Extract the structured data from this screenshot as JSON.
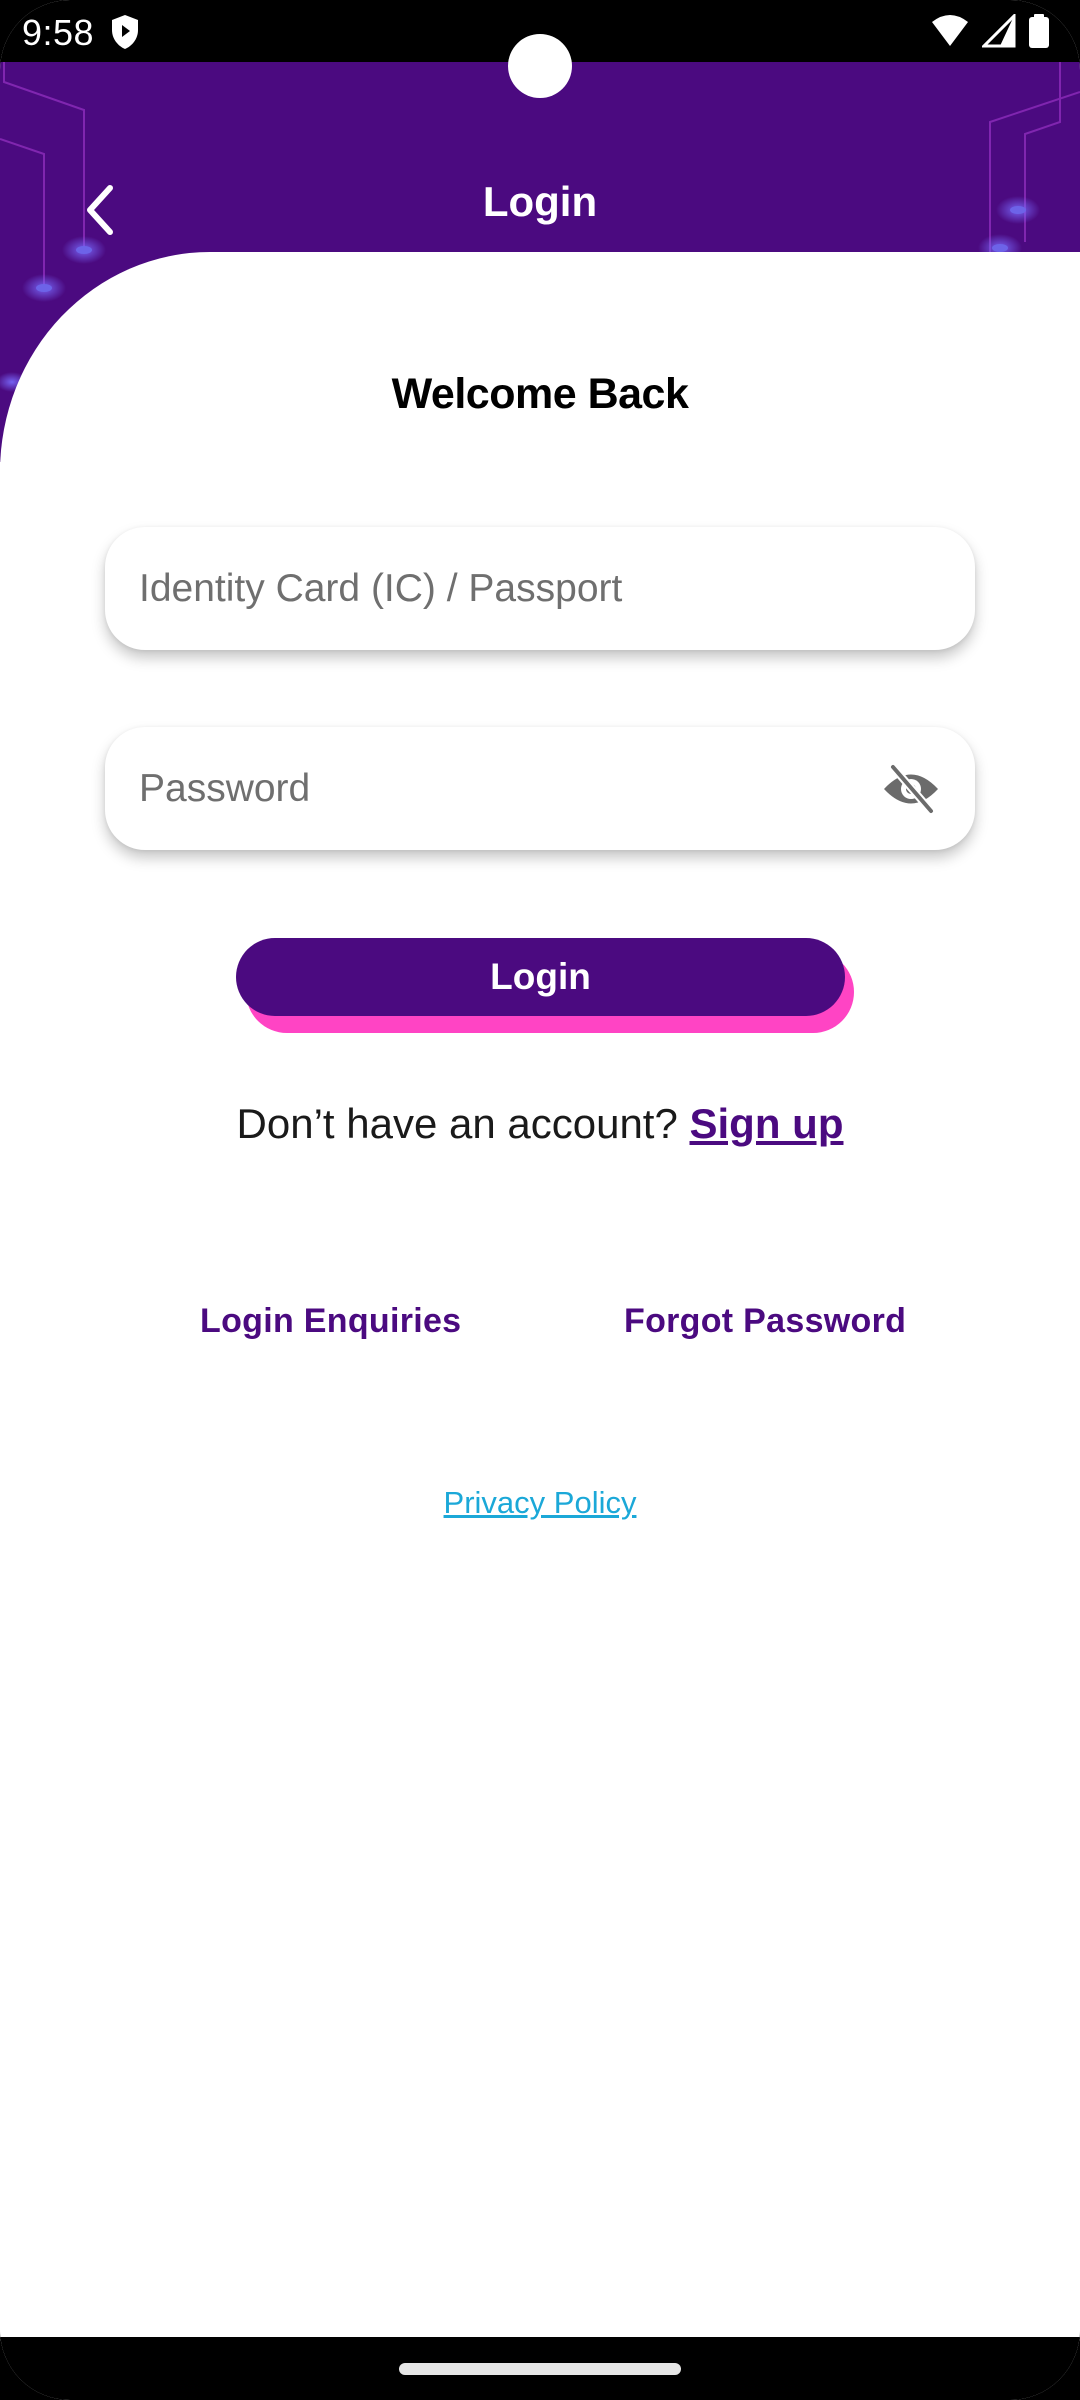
{
  "status_bar": {
    "time": "9:58",
    "left_icons": [
      "shield-play-icon"
    ],
    "right_icons": [
      "wifi-icon",
      "cell-signal-icon",
      "battery-icon"
    ]
  },
  "header": {
    "title": "Login",
    "back_icon": "chevron-left-icon",
    "background_color": "#4B0A80"
  },
  "main": {
    "heading": "Welcome Back",
    "ic_field": {
      "placeholder": "Identity Card (IC) / Passport",
      "value": ""
    },
    "password_field": {
      "placeholder": "Password",
      "value": "",
      "toggle_icon": "eye-off-icon"
    },
    "login_button": {
      "label": "Login",
      "color": "#4B0A80",
      "shadow_color": "#FF44C4"
    },
    "signup_prompt": "Don’t have an account?",
    "signup_link": "Sign up",
    "links": {
      "login_enquiries": "Login Enquiries",
      "forgot_password": "Forgot Password"
    },
    "privacy_policy": "Privacy Policy",
    "privacy_color": "#1BA8D8"
  }
}
